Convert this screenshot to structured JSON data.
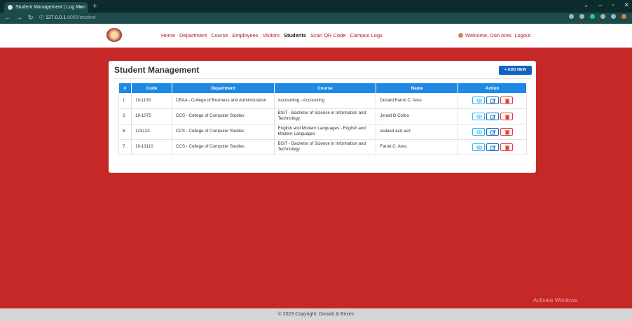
{
  "browser": {
    "tab_title": "Student Management | Log Man",
    "tab_close": "×",
    "new_tab": "+",
    "url_host": "127.0.0.1",
    "url_path": ":8000/student"
  },
  "navbar": {
    "menu": [
      "Home",
      "Department",
      "Course",
      "Employees",
      "Visitors",
      "Students",
      "Scan QR Code",
      "Campus Logs"
    ],
    "active": "Students",
    "welcome": "Welcome, Don Ares",
    "logout": "Logout"
  },
  "page": {
    "title": "Student Management",
    "add_button": "+ ADD NEW"
  },
  "table": {
    "headers": [
      "#",
      "Code",
      "Department",
      "Course",
      "Name",
      "Action"
    ],
    "rows": [
      {
        "num": "1",
        "code": "19-1130",
        "department": "CBAA - College of Business and Administration",
        "course": "Accounting - Accounting",
        "name": "Donald Farrel C. Ares"
      },
      {
        "num": "2",
        "code": "19-1075",
        "department": "CCS - College of Computer Studies",
        "course": "BSIT - Bachelor of Science in Information and Technology",
        "name": "Jerald D Corbo"
      },
      {
        "num": "6",
        "code": "123123",
        "department": "CCS - College of Computer Studies",
        "course": "English and Modern Languages - English and Modern Languages",
        "name": "asdasd asd asd"
      },
      {
        "num": "7",
        "code": "19-13110",
        "department": "CCS - College of Computer Studies",
        "course": "BSIT - Bachelor of Science in Information and Technology",
        "name": "Farrel C. Ares"
      }
    ]
  },
  "os": {
    "watermark": "Activate Windows"
  },
  "footer": {
    "text": "© 2023 Copyright: Donald & Brixes"
  },
  "colors": {
    "background": "#c62828",
    "table_header": "#1e88e5",
    "add_button": "#1565c0"
  }
}
